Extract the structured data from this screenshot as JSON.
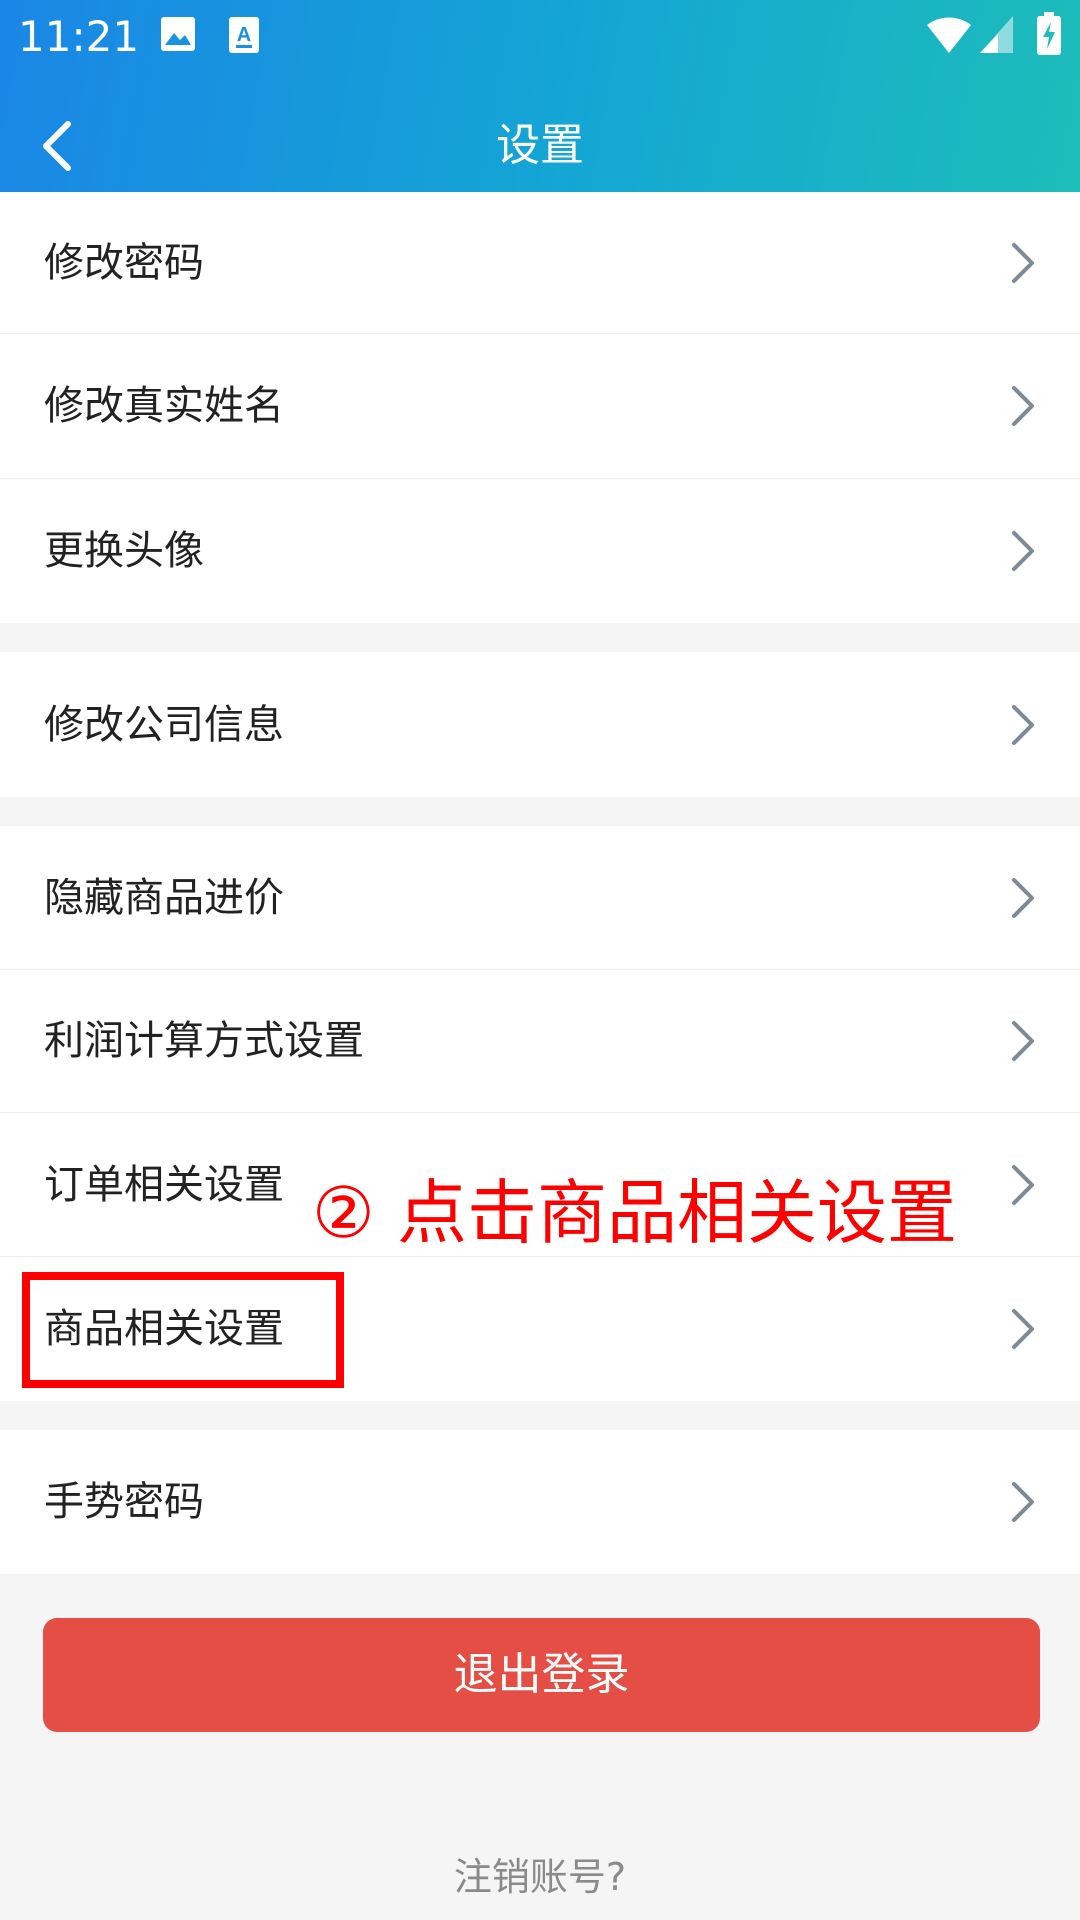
{
  "status_bar": {
    "time": "11:21",
    "icons": [
      "image-icon",
      "accessibility-icon",
      "wifi-icon",
      "signal-icon",
      "battery-icon"
    ]
  },
  "header": {
    "title": "设置",
    "back_icon": "chevron-left-icon"
  },
  "menu": {
    "items": [
      {
        "label": "修改密码"
      },
      {
        "label": "修改真实姓名"
      },
      {
        "label": "更换头像"
      },
      {
        "label": "修改公司信息"
      },
      {
        "label": "隐藏商品进价"
      },
      {
        "label": "利润计算方式设置"
      },
      {
        "label": "订单相关设置"
      },
      {
        "label": "商品相关设置"
      },
      {
        "label": "手势密码"
      }
    ]
  },
  "annotation": {
    "text": "② 点击商品相关设置",
    "color": "#ff0000"
  },
  "logout_button": {
    "label": "退出登录",
    "color": "#e44e45"
  },
  "cancel_account_link": {
    "label": "注销账号?"
  },
  "colors": {
    "header_start": "#1a86e6",
    "header_end": "#1ebdb9",
    "background": "#f5f5f5"
  }
}
